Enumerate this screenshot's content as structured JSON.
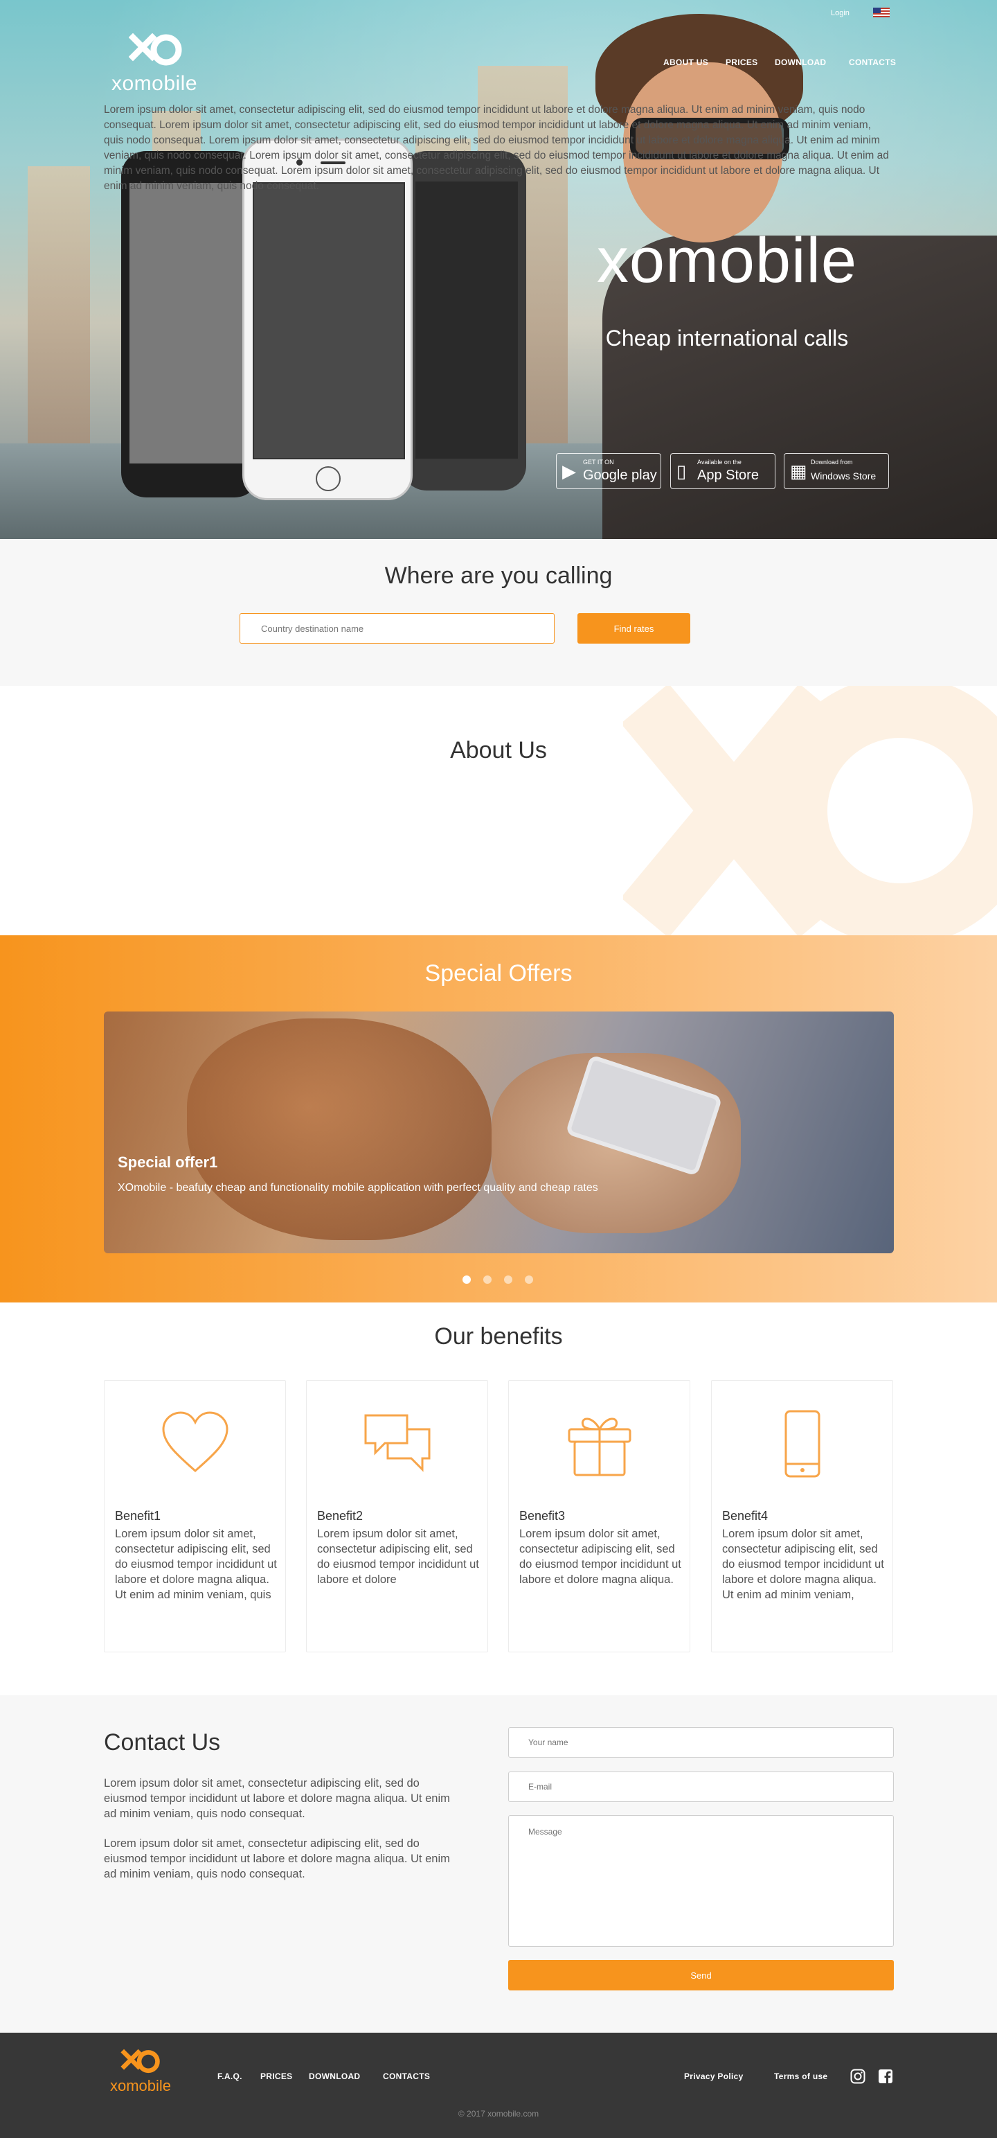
{
  "header": {
    "login": "Login",
    "brand": "xomobile",
    "nav": [
      "ABOUT US",
      "PRICES",
      "DOWNLOAD",
      "CONTACTS"
    ]
  },
  "hero": {
    "title": "xomobile",
    "subtitle": "Cheap international calls",
    "stores": [
      {
        "small": "GET IT ON",
        "big": "Google play",
        "icon": "play-store-icon"
      },
      {
        "small": "Available on the",
        "big": "App Store",
        "icon": "apple-icon"
      },
      {
        "small": "Download from",
        "big": "Windows Store",
        "icon": "windows-icon"
      }
    ]
  },
  "search": {
    "title": "Where are you calling",
    "placeholder": "Country destination name",
    "button": "Find rates"
  },
  "about": {
    "title": "About Us",
    "text": "Lorem ipsum dolor sit amet, consectetur adipiscing elit, sed do eiusmod tempor incididunt ut labore et dolore magna aliqua. Ut enim ad minim veniam, quis nodo consequat. Lorem ipsum dolor sit amet, consectetur adipiscing elit, sed do eiusmod tempor incididunt ut labore et dolore magna aliqua. Ut enim ad minim veniam, quis nodo consequat. Lorem ipsum dolor sit amet, consectetur adipiscing elit, sed do eiusmod tempor incididunt ut labore et dolore magna aliqua. Ut enim ad minim veniam, quis nodo consequat. Lorem ipsum dolor sit amet, consectetur adipiscing elit, sed do eiusmod tempor incididunt ut labore et dolore magna aliqua. Ut enim ad minim veniam, quis nodo consequat. Lorem ipsum dolor sit amet, consectetur adipiscing elit, sed do eiusmod tempor incididunt ut labore et dolore magna aliqua. Ut enim ad minim veniam, quis nodo consequat."
  },
  "offers": {
    "title": "Special Offers",
    "slide_title": "Special offer1",
    "slide_desc": "XOmobile - beafuty cheap and functionality mobile application with perfect quality and cheap rates",
    "dots": 4,
    "active_dot": 1
  },
  "benefits": {
    "title": "Our benefits",
    "items": [
      {
        "title": "Benefit1",
        "icon": "heart-icon",
        "text": "Lorem ipsum dolor sit amet, consectetur adipiscing elit, sed do eiusmod tempor incididunt ut labore et dolore magna aliqua.",
        "text2": "Ut enim ad minim veniam, quis"
      },
      {
        "title": "Benefit2",
        "icon": "chat-icon",
        "text": "Lorem ipsum dolor sit amet, consectetur adipiscing elit, sed do eiusmod tempor incididunt ut labore et dolore",
        "text2": ""
      },
      {
        "title": "Benefit3",
        "icon": "gift-icon",
        "text": "Lorem ipsum dolor sit amet, consectetur adipiscing elit, sed do eiusmod tempor incididunt ut labore et dolore magna aliqua.",
        "text2": ""
      },
      {
        "title": "Benefit4",
        "icon": "mobile-phone-icon",
        "text": "Lorem ipsum dolor sit amet, consectetur adipiscing elit, sed do eiusmod tempor incididunt ut labore et dolore magna aliqua.",
        "text2": "Ut enim ad minim veniam,"
      }
    ]
  },
  "contact": {
    "title": "Contact Us",
    "p1": "Lorem ipsum dolor sit amet, consectetur adipiscing elit, sed do eiusmod tempor incididunt ut labore et dolore magna aliqua. Ut enim ad minim veniam, quis nodo consequat.",
    "p2": "Lorem ipsum dolor sit amet, consectetur adipiscing elit, sed do eiusmod tempor incididunt ut labore et dolore magna aliqua. Ut enim ad minim veniam, quis nodo consequat.",
    "name_placeholder": "Your name",
    "email_placeholder": "E-mail",
    "message_placeholder": "Message",
    "send": "Send"
  },
  "footer": {
    "brand": "xomobile",
    "links": [
      "F.A.Q.",
      "PRICES",
      "DOWNLOAD",
      "CONTACTS"
    ],
    "privacy": "Privacy Policy",
    "terms": "Terms of use",
    "copyright": "© 2017 xomobile.com"
  },
  "colors": {
    "accent": "#f7941d",
    "footer": "#373737",
    "light_bg": "#f7f7f7"
  }
}
